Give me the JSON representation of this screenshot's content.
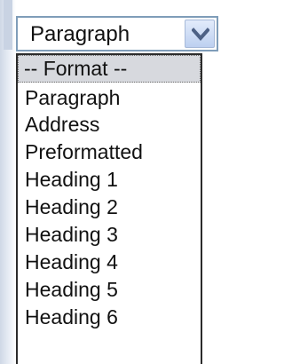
{
  "format_select": {
    "selected_value": "Paragraph",
    "dropdown_icon": "chevron-down-icon",
    "options": [
      "-- Format --",
      "Paragraph",
      "Address",
      "Preformatted",
      "Heading 1",
      "Heading 2",
      "Heading 3",
      "Heading 4",
      "Heading 5",
      "Heading 6"
    ],
    "highlighted_option_index": 0
  },
  "colors": {
    "select_border": "#7f9db9",
    "button_gradient_top": "#e2ebfb",
    "button_gradient_bottom": "#bdd0f0",
    "arrow": "#4d6185",
    "highlight_background": "#d7d9de"
  }
}
